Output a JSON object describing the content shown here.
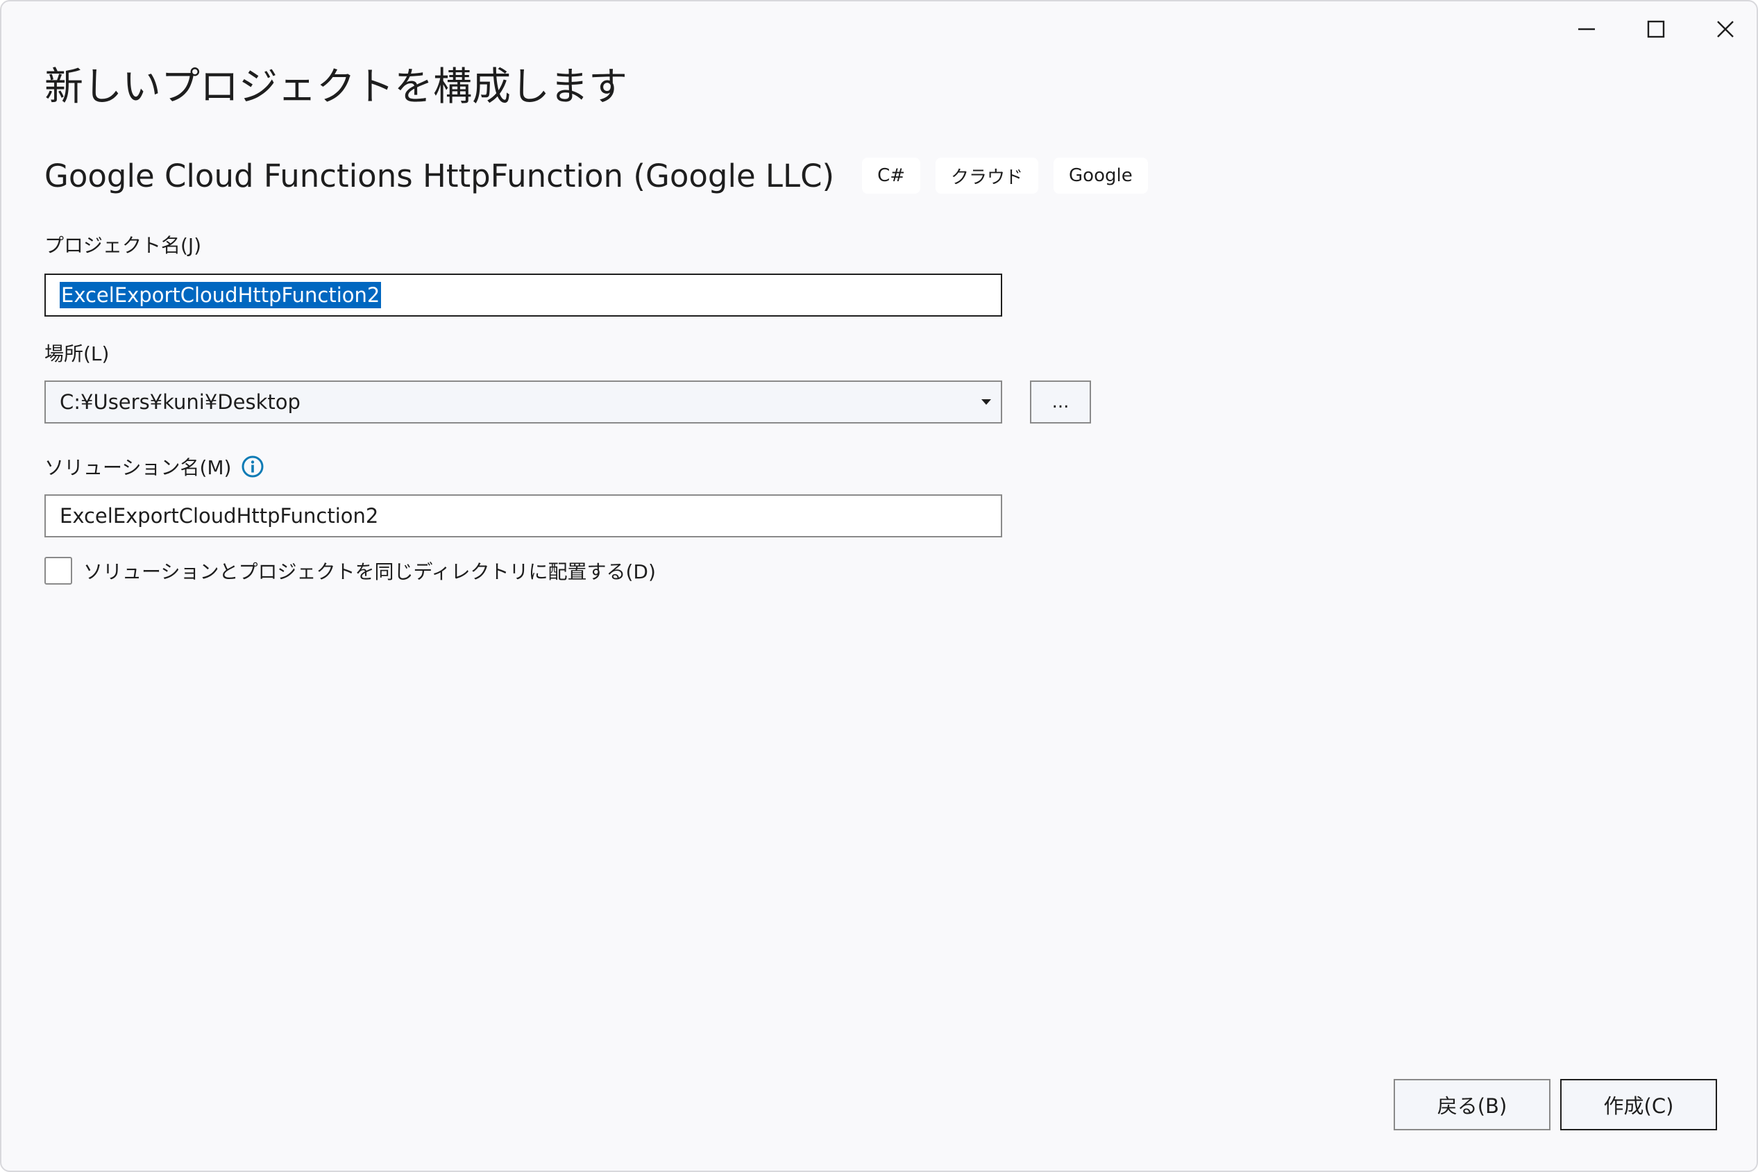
{
  "window": {
    "title": "新しいプロジェクトを構成します",
    "controls": {
      "minimize": "minimize-icon",
      "maximize": "maximize-icon",
      "close": "close-icon"
    }
  },
  "template": {
    "name": "Google Cloud Functions HttpFunction (Google LLC)",
    "tags": [
      "C#",
      "クラウド",
      "Google"
    ]
  },
  "project_name": {
    "label": "プロジェクト名(J)",
    "value": "ExcelExportCloudHttpFunction2"
  },
  "location": {
    "label": "場所(L)",
    "value": "C:¥Users¥kuni¥Desktop",
    "browse_label": "..."
  },
  "solution_name": {
    "label": "ソリューション名(M)",
    "value": "ExcelExportCloudHttpFunction2",
    "info_icon": "info-icon"
  },
  "same_directory": {
    "label": "ソリューションとプロジェクトを同じディレクトリに配置する(D)",
    "checked": false
  },
  "buttons": {
    "back": "戻る(B)",
    "create": "作成(C)"
  },
  "colors": {
    "accent": "#0067c0",
    "info": "#0e7bb5",
    "background": "#f9f9fb"
  }
}
